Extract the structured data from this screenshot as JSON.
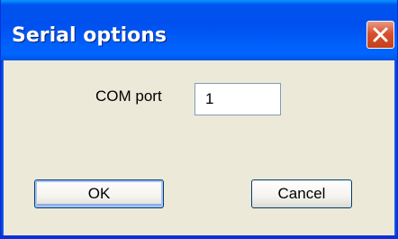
{
  "window": {
    "title": "Serial options"
  },
  "form": {
    "com_port_label": "COM port",
    "com_port_value": "1"
  },
  "buttons": {
    "ok_label": "OK",
    "cancel_label": "Cancel"
  },
  "icons": {
    "close": "close-icon"
  },
  "colors": {
    "titlebar": "#0053ee",
    "close_button": "#d8512e",
    "dialog_background": "#ece9d8"
  }
}
